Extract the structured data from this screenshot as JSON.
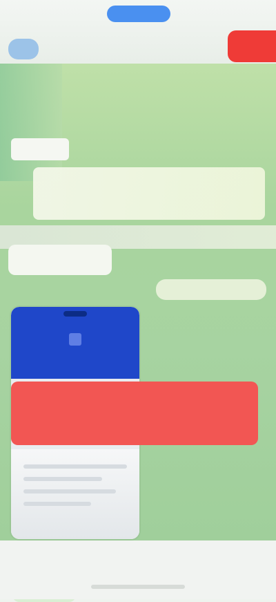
{
  "top_tabs": [
    {
      "label": ""
    },
    {
      "label": ""
    },
    {
      "label": ""
    }
  ],
  "header": {
    "subtitle": ""
  },
  "panel": {
    "tag": "",
    "banner_text": "",
    "mini_pill": ""
  },
  "callout": {
    "text": ""
  },
  "colors": {
    "accent_blue": "#4a90f0",
    "alert_red": "#ef3b37",
    "panel_green": "#a7d3a1"
  }
}
